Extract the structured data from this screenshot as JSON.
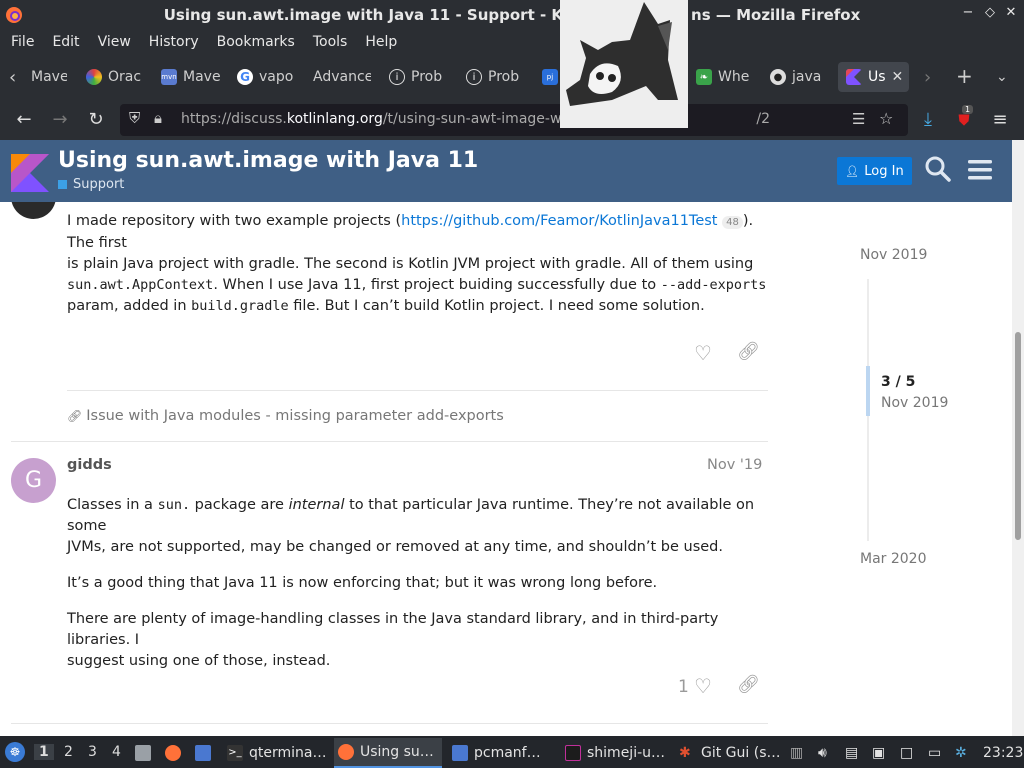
{
  "window": {
    "title": "Using sun.awt.image with Java 11 - Support - K                                 ns — Mozilla Firefox",
    "title_visible_left": "Using sun.awt.image with Java 11 - Support - K",
    "title_visible_right": "ns — Mozilla Firefox",
    "controls": [
      "−",
      "◇",
      "✕"
    ]
  },
  "menu": [
    {
      "label": "File",
      "u": "F"
    },
    {
      "label": "Edit",
      "u": "E"
    },
    {
      "label": "View",
      "u": "V"
    },
    {
      "label": "History",
      "u": "s"
    },
    {
      "label": "Bookmarks",
      "u": "B"
    },
    {
      "label": "Tools",
      "u": "T"
    },
    {
      "label": "Help",
      "u": "H"
    }
  ],
  "tabs": [
    {
      "label": "Mave",
      "icon": "maven-icon",
      "color": "#2b2e33"
    },
    {
      "label": "Orac",
      "icon": "oracle-icon",
      "color": "#e0a020"
    },
    {
      "label": "Mave",
      "icon": "mvn-icon",
      "color": "#5a7bd0"
    },
    {
      "label": "vapo",
      "icon": "google-icon",
      "color": "#ffffff"
    },
    {
      "label": "Advance",
      "icon": "",
      "color": ""
    },
    {
      "label": "Prob",
      "icon": "info-icon",
      "color": ""
    },
    {
      "label": "Prob",
      "icon": "info-icon",
      "color": ""
    },
    {
      "label": "",
      "icon": "pj-icon",
      "color": "#2a6fdb"
    },
    {
      "label": "Whe",
      "icon": "leaf-icon",
      "color": "#3aa34a"
    },
    {
      "label": "java",
      "icon": "github-icon",
      "color": ""
    },
    {
      "label": "Us",
      "icon": "kotlin-icon",
      "color": ""
    }
  ],
  "url": {
    "prefix": "https://discuss.",
    "domain": "kotlinlang.org",
    "path": "/t/using-sun-awt-image-w",
    "suffix": "/2"
  },
  "header": {
    "title": "Using sun.awt.image with Java 11",
    "category": "Support",
    "login": "Log In"
  },
  "post1": {
    "line1_pre": "I made repository with two example projects (",
    "link": "https://github.com/Feamor/KotlinJava11Test",
    "link_count": "48",
    "line1_post": "). The first",
    "line2": "is plain Java project with gradle. The second is Kotlin JVM project with gradle. All of them using",
    "code1": "sun.awt.AppContext",
    "line3_mid": ". When I use Java 11, first project buiding successfully due to ",
    "code2": "--add-exports",
    "line4_pre": "param, added in ",
    "code3": "build.gradle",
    "line4_post": " file. But I can’t build Kotlin project. I need some solution."
  },
  "linked_topic": "Issue with Java modules - missing parameter add-exports",
  "post2": {
    "author": "gidds",
    "avatar_letter": "G",
    "avatar_color": "#c7a0cf",
    "date": "Nov '19",
    "p1_pre": "Classes in a ",
    "p1_code": "sun.",
    "p1_mid": " package are ",
    "p1_em": "internal",
    "p1_post": " to that particular Java runtime. They’re not available on some",
    "p1_line2": "JVMs, are not supported, may be changed or removed at any time, and shouldn’t be used.",
    "p2": "It’s a good thing that Java 11 is now enforcing that; but it was wrong long before.",
    "p3_line1": "There are plenty of image-handling classes in the Java standard library, and in third-party libraries. I",
    "p3_line2": "suggest using one of those, instead.",
    "likes": "1"
  },
  "timeline": {
    "top_date": "Nov 2019",
    "position": "3 / 5",
    "position_date": "Nov 2019",
    "bottom_date": "Mar 2020"
  },
  "taskbar": {
    "workspaces": [
      "1",
      "2",
      "3",
      "4"
    ],
    "items": [
      {
        "label": "qtermina…",
        "icon": "terminal-icon"
      },
      {
        "label": "Using su…",
        "icon": "firefox-icon"
      },
      {
        "label": "pcmanf…",
        "icon": "folder-icon"
      },
      {
        "label": "shimeji-u…",
        "icon": "intellij-icon"
      },
      {
        "label": "Git Gui (s…",
        "icon": "git-icon"
      }
    ],
    "clock": "23:23"
  },
  "colors": {
    "header_bg": "#3f5f85",
    "accent": "#0b77d6",
    "category": "#3ca0e6"
  }
}
